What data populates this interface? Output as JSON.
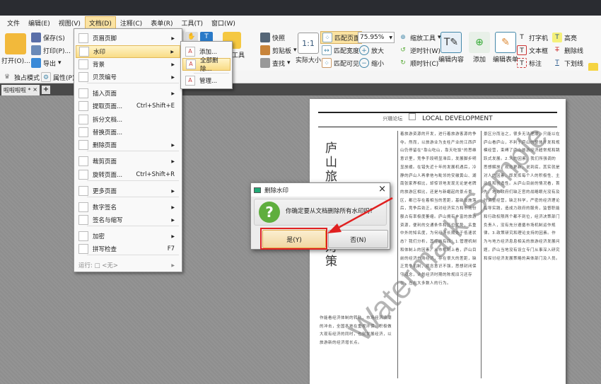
{
  "menubar": [
    "文件",
    "编辑(E)",
    "视图(V)",
    "文档(D)",
    "注释(C)",
    "表单(R)",
    "工具(T)",
    "窗口(W)"
  ],
  "toolbar": {
    "open": "打开(O)...",
    "save": "保存(S)",
    "print": "打印(P)...",
    "export": "导出",
    "exclusive": "独占模式",
    "properties": "属性(P)...",
    "annot_tool": "注释工具",
    "snapshot": "快照",
    "clipboard": "剪贴板",
    "find": "查找",
    "actual_size": "实际大小",
    "fit_page": "匹配页面",
    "fit_width": "匹配宽度",
    "fit_visible": "匹配可见",
    "zoom_value": "75.95%",
    "zoom_in": "放大",
    "zoom_out": "缩小",
    "zoom_tool": "缩放工具",
    "ccw": "逆时针(W)",
    "cw": "顺时针(C)",
    "edit_content": "编辑内容",
    "add": "添加",
    "edit_form": "编辑表单",
    "typewriter": "打字机",
    "textbox": "文本框",
    "callout": "标注",
    "highlight": "高亮",
    "strikeout": "删除线",
    "underline": "下划线"
  },
  "tab": {
    "label": "啦啦啦啦 *",
    "close": "×",
    "add": "+"
  },
  "doc_menu": {
    "items": [
      {
        "label": "页眉页脚",
        "sub": true
      },
      {
        "label": "水印",
        "sub": true
      },
      {
        "label": "背景",
        "sub": true
      },
      {
        "label": "贝茨编号",
        "sub": true
      },
      {
        "label": "插入页面",
        "sub": true
      },
      {
        "label": "提取页面...",
        "shortcut": "Ctrl+Shift+E"
      },
      {
        "label": "拆分文档..."
      },
      {
        "label": "替换页面..."
      },
      {
        "label": "删除页面",
        "sub": true
      },
      {
        "label": "裁剪页面",
        "sub": true
      },
      {
        "label": "旋转页面...",
        "shortcut": "Ctrl+Shift+R"
      },
      {
        "label": "更多页面",
        "sub": true
      },
      {
        "label": "数字签名",
        "sub": true
      },
      {
        "label": "签名与缩写",
        "sub": true
      },
      {
        "label": "加密",
        "sub": true
      },
      {
        "label": "拼写检查",
        "shortcut": "F7"
      },
      {
        "label": "运行: □ <无>",
        "sub": true
      }
    ]
  },
  "watermark_menu": [
    "添加...",
    "全部删除...",
    "管理..."
  ],
  "dialog": {
    "title": "删除水印",
    "message": "你确定要从文档删除所有水印吗?",
    "yes": "是(Y)",
    "no": "否(N)"
  },
  "document": {
    "header_cn": "兴赣论坛",
    "header_en": "LOCAL DEVELOPMENT",
    "title": "庐山旅游现状与对策",
    "col1": "作能看经济体制的转轨，市场经济浪潮的冲击，全国各地在重视环保、积极做大现有经济的同时，也则发展经济，以旅游新的经济增长点。",
    "col2": "着旅游资源的开发，进行着旅游客源的争夺。然而，以旅游业为支柱产业的江西庐山仍停留在\"靠山吃山，靠天吃饭\"的思维意识里，竞争手段明显滞后，发展脚步明显放缓。在错失近十年的发展机遇后，冷静的庐山人再拿他与毗邻的安徽黄山、湖南张家界相比，却惊讶地发现无论是老牌的旅游区相比，还是与新崛起的景点景区，都已存在着相当的差距，基础设施落后，竞争后劲乏，相对经济实力和市场份额占有率极度萎缩。庐山拥有丰富的旅游资源，便利的交通条件和区位优势，名重中外的知名度，为何经济长期处于低速状态？我们分析，其症结有四：1.管理机制和体制上的因素。从市机制上看，庐山目前的经济市场经济，存在很大的差距，缺乏竞争机制，观念意识不强，思想封闭保守观念，计划经济时期的陈规旧习还存在，左右大多数人的行为。",
    "col3": "景区分而治之，很多无法理顺，只能以在庐山看庐山，不利于庐山的整体开发和规模经营，束缚了庐山旅游经济超常规和跳跃式发展。2.人的因素。我们所强调的思想解放，观念更新，说到底，其实就是对人的因素，即发挥每个人的积极性、主动性和创造性。从庐山目前的情况看，首先，地方政府们缺乏官的战略眼光没有及时调整经营，缺乏科学，严密的经济理论指导实践，造成力政府的服务，监督职能和行政权限两个都不到位，经济决策部门负责人，没有充分遵循市场机制运作规律。3.政策研究和理论支持的因素。作为与地方经济息息相关的旅游经济发展问题，庐山当地没有设立专门从事深入研究和探讨经济发展策略的具体部门及人员。",
    "watermark": "Watermark Sample"
  }
}
